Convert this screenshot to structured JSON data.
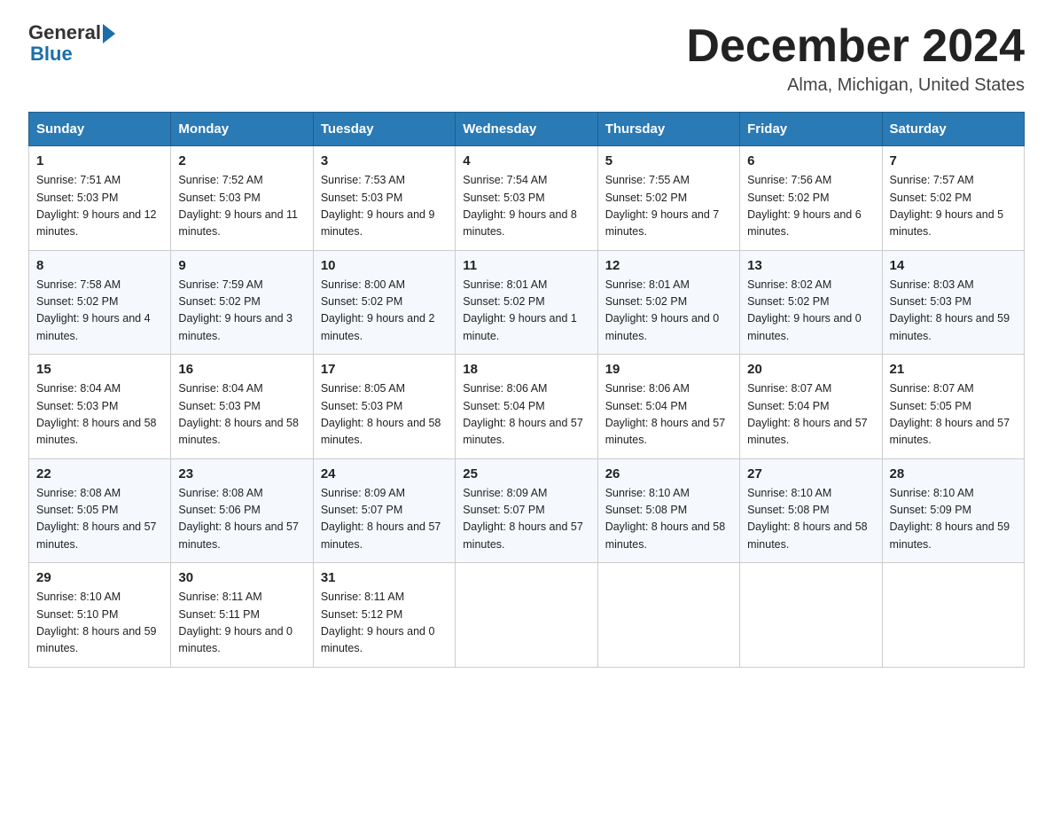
{
  "header": {
    "logo_general": "General",
    "logo_blue": "Blue",
    "month_title": "December 2024",
    "location": "Alma, Michigan, United States"
  },
  "weekdays": [
    "Sunday",
    "Monday",
    "Tuesday",
    "Wednesday",
    "Thursday",
    "Friday",
    "Saturday"
  ],
  "weeks": [
    [
      {
        "day": "1",
        "sunrise": "7:51 AM",
        "sunset": "5:03 PM",
        "daylight": "9 hours and 12 minutes."
      },
      {
        "day": "2",
        "sunrise": "7:52 AM",
        "sunset": "5:03 PM",
        "daylight": "9 hours and 11 minutes."
      },
      {
        "day": "3",
        "sunrise": "7:53 AM",
        "sunset": "5:03 PM",
        "daylight": "9 hours and 9 minutes."
      },
      {
        "day": "4",
        "sunrise": "7:54 AM",
        "sunset": "5:03 PM",
        "daylight": "9 hours and 8 minutes."
      },
      {
        "day": "5",
        "sunrise": "7:55 AM",
        "sunset": "5:02 PM",
        "daylight": "9 hours and 7 minutes."
      },
      {
        "day": "6",
        "sunrise": "7:56 AM",
        "sunset": "5:02 PM",
        "daylight": "9 hours and 6 minutes."
      },
      {
        "day": "7",
        "sunrise": "7:57 AM",
        "sunset": "5:02 PM",
        "daylight": "9 hours and 5 minutes."
      }
    ],
    [
      {
        "day": "8",
        "sunrise": "7:58 AM",
        "sunset": "5:02 PM",
        "daylight": "9 hours and 4 minutes."
      },
      {
        "day": "9",
        "sunrise": "7:59 AM",
        "sunset": "5:02 PM",
        "daylight": "9 hours and 3 minutes."
      },
      {
        "day": "10",
        "sunrise": "8:00 AM",
        "sunset": "5:02 PM",
        "daylight": "9 hours and 2 minutes."
      },
      {
        "day": "11",
        "sunrise": "8:01 AM",
        "sunset": "5:02 PM",
        "daylight": "9 hours and 1 minute."
      },
      {
        "day": "12",
        "sunrise": "8:01 AM",
        "sunset": "5:02 PM",
        "daylight": "9 hours and 0 minutes."
      },
      {
        "day": "13",
        "sunrise": "8:02 AM",
        "sunset": "5:02 PM",
        "daylight": "9 hours and 0 minutes."
      },
      {
        "day": "14",
        "sunrise": "8:03 AM",
        "sunset": "5:03 PM",
        "daylight": "8 hours and 59 minutes."
      }
    ],
    [
      {
        "day": "15",
        "sunrise": "8:04 AM",
        "sunset": "5:03 PM",
        "daylight": "8 hours and 58 minutes."
      },
      {
        "day": "16",
        "sunrise": "8:04 AM",
        "sunset": "5:03 PM",
        "daylight": "8 hours and 58 minutes."
      },
      {
        "day": "17",
        "sunrise": "8:05 AM",
        "sunset": "5:03 PM",
        "daylight": "8 hours and 58 minutes."
      },
      {
        "day": "18",
        "sunrise": "8:06 AM",
        "sunset": "5:04 PM",
        "daylight": "8 hours and 57 minutes."
      },
      {
        "day": "19",
        "sunrise": "8:06 AM",
        "sunset": "5:04 PM",
        "daylight": "8 hours and 57 minutes."
      },
      {
        "day": "20",
        "sunrise": "8:07 AM",
        "sunset": "5:04 PM",
        "daylight": "8 hours and 57 minutes."
      },
      {
        "day": "21",
        "sunrise": "8:07 AM",
        "sunset": "5:05 PM",
        "daylight": "8 hours and 57 minutes."
      }
    ],
    [
      {
        "day": "22",
        "sunrise": "8:08 AM",
        "sunset": "5:05 PM",
        "daylight": "8 hours and 57 minutes."
      },
      {
        "day": "23",
        "sunrise": "8:08 AM",
        "sunset": "5:06 PM",
        "daylight": "8 hours and 57 minutes."
      },
      {
        "day": "24",
        "sunrise": "8:09 AM",
        "sunset": "5:07 PM",
        "daylight": "8 hours and 57 minutes."
      },
      {
        "day": "25",
        "sunrise": "8:09 AM",
        "sunset": "5:07 PM",
        "daylight": "8 hours and 57 minutes."
      },
      {
        "day": "26",
        "sunrise": "8:10 AM",
        "sunset": "5:08 PM",
        "daylight": "8 hours and 58 minutes."
      },
      {
        "day": "27",
        "sunrise": "8:10 AM",
        "sunset": "5:08 PM",
        "daylight": "8 hours and 58 minutes."
      },
      {
        "day": "28",
        "sunrise": "8:10 AM",
        "sunset": "5:09 PM",
        "daylight": "8 hours and 59 minutes."
      }
    ],
    [
      {
        "day": "29",
        "sunrise": "8:10 AM",
        "sunset": "5:10 PM",
        "daylight": "8 hours and 59 minutes."
      },
      {
        "day": "30",
        "sunrise": "8:11 AM",
        "sunset": "5:11 PM",
        "daylight": "9 hours and 0 minutes."
      },
      {
        "day": "31",
        "sunrise": "8:11 AM",
        "sunset": "5:12 PM",
        "daylight": "9 hours and 0 minutes."
      },
      null,
      null,
      null,
      null
    ]
  ]
}
